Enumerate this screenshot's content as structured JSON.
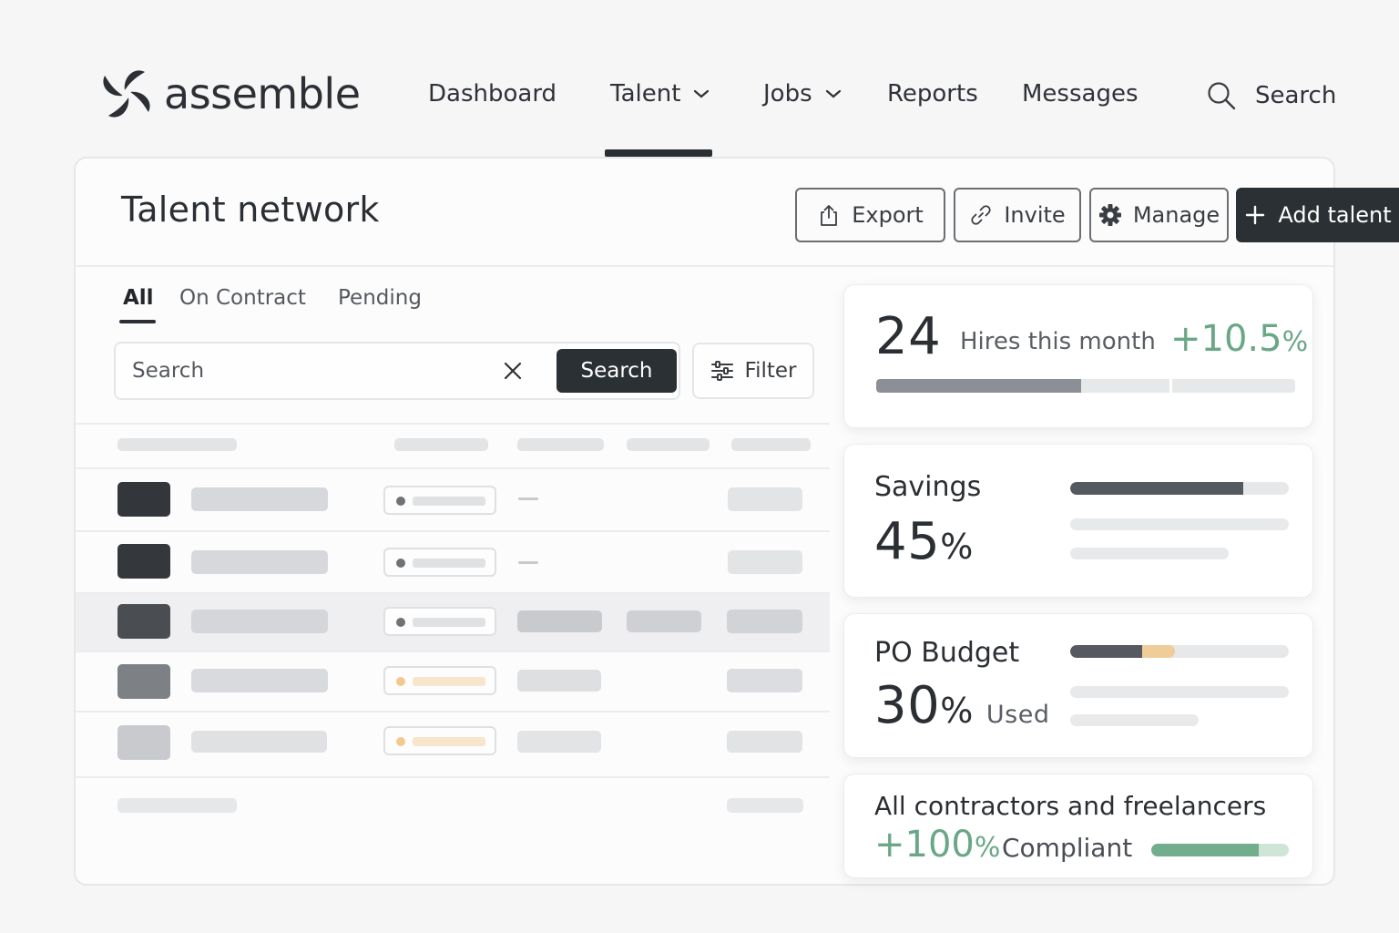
{
  "brand": {
    "name": "assemble"
  },
  "nav": {
    "items": [
      {
        "label": "Dashboard",
        "has_dropdown": false,
        "active": false
      },
      {
        "label": "Talent",
        "has_dropdown": true,
        "active": true
      },
      {
        "label": "Jobs",
        "has_dropdown": true,
        "active": false
      },
      {
        "label": "Reports",
        "has_dropdown": false,
        "active": false
      },
      {
        "label": "Messages",
        "has_dropdown": false,
        "active": false
      }
    ],
    "search_label": "Search",
    "search_icon": "search-icon"
  },
  "page": {
    "title": "Talent network",
    "toolbar": {
      "export_label": "Export",
      "invite_label": "Invite",
      "manage_label": "Manage",
      "add_label": "Add talent"
    },
    "tabs": [
      {
        "label": "All",
        "active": true
      },
      {
        "label": "On Contract",
        "active": false
      },
      {
        "label": "Pending",
        "active": false
      }
    ],
    "search": {
      "placeholder": "Search",
      "button_label": "Search"
    },
    "filter_label": "Filter"
  },
  "table": {
    "rows": [
      {
        "avatar_color": "#33373c",
        "status_color": "#6f7378",
        "has_dash": true
      },
      {
        "avatar_color": "#34383d",
        "status_color": "#6f7378",
        "has_dash": true
      },
      {
        "avatar_color": "#4a4d52",
        "status_color": "#6f7378",
        "has_dash": false,
        "highlighted": true
      },
      {
        "avatar_color": "#7d8085",
        "status_color": "#f2c98f",
        "has_dash": false
      },
      {
        "avatar_color": "#c9cacd",
        "status_color": "#f2c98f",
        "has_dash": false
      }
    ]
  },
  "stats": {
    "hires": {
      "value": "24",
      "label": "Hires this month",
      "change": "+10.5",
      "change_unit": "%",
      "progress": 0.49
    },
    "savings": {
      "title": "Savings",
      "value": "45",
      "unit": "%",
      "progress": 0.79
    },
    "po_budget": {
      "title": "PO Budget",
      "value": "30",
      "unit": "%",
      "suffix": "Used",
      "progress_used": 0.33,
      "progress_pending": 0.15
    },
    "compliance": {
      "title": "All contractors and freelancers",
      "value": "+100",
      "unit": "%",
      "label": "Compliant",
      "progress": 0.78
    }
  },
  "colors": {
    "primary_dark": "#2b3034",
    "accent_green": "#6aa787",
    "amber": "#f2c98f"
  }
}
